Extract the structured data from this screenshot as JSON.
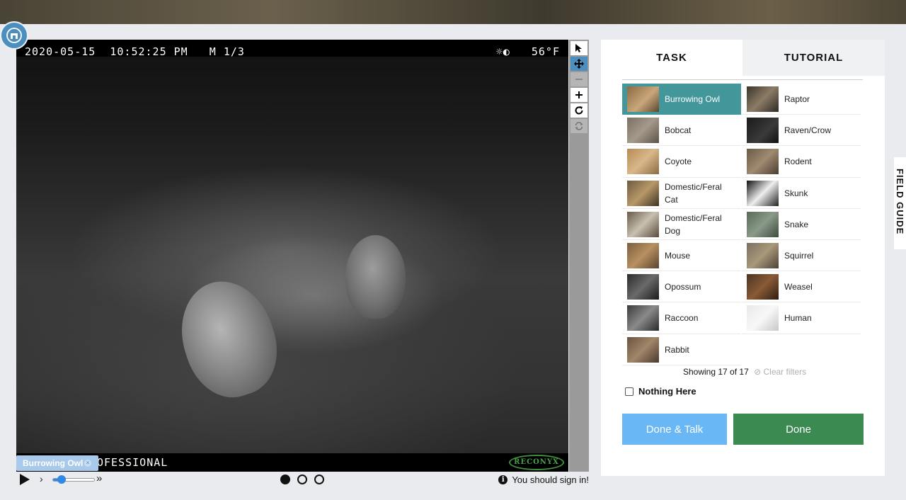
{
  "colors": {
    "accent": "#4c8fbe",
    "selected_choice": "#43979b",
    "done_talk_button": "#6ab7f5",
    "done_button": "#3b8a51",
    "tag_chip": "#a8c9ea"
  },
  "camera": {
    "overlay_date": "2020-05-15  10:52:25 PM   M 1/3",
    "overlay_temp": "☼◐   56°F",
    "overlay_brand": "OFESSIONAL",
    "logo_text": "RECONYX"
  },
  "tag": {
    "label": "Burrowing Owl",
    "remove_icon": "close-icon"
  },
  "toolbar": {
    "tools": [
      "pointer-icon",
      "move-icon",
      "zoom-out-icon",
      "zoom-in-icon",
      "rotate-icon",
      "reset-icon"
    ],
    "active_tool": "move-icon"
  },
  "playback": {
    "speed_level": 0.15,
    "frames": 3,
    "current_frame": 1,
    "signin_message": "You should sign in!"
  },
  "panel": {
    "tabs": [
      {
        "label": "TASK"
      },
      {
        "label": "TUTORIAL"
      }
    ],
    "active_tab": "TASK",
    "choices": [
      {
        "label": "Burrowing Owl",
        "selected": true
      },
      {
        "label": "Raptor"
      },
      {
        "label": "Bobcat"
      },
      {
        "label": "Raven/Crow"
      },
      {
        "label": "Coyote"
      },
      {
        "label": "Rodent"
      },
      {
        "label": "Domestic/Feral Cat"
      },
      {
        "label": "Skunk"
      },
      {
        "label": "Domestic/Feral Dog"
      },
      {
        "label": "Snake"
      },
      {
        "label": "Mouse"
      },
      {
        "label": "Squirrel"
      },
      {
        "label": "Opossum"
      },
      {
        "label": "Weasel"
      },
      {
        "label": "Raccoon"
      },
      {
        "label": "Human"
      },
      {
        "label": "Rabbit"
      }
    ],
    "showing_text": "Showing 17 of 17",
    "clear_filters": "Clear filters",
    "nothing_here": "Nothing Here",
    "done_talk": "Done & Talk",
    "done": "Done"
  },
  "field_guide": {
    "label": "FIELD GUIDE"
  }
}
